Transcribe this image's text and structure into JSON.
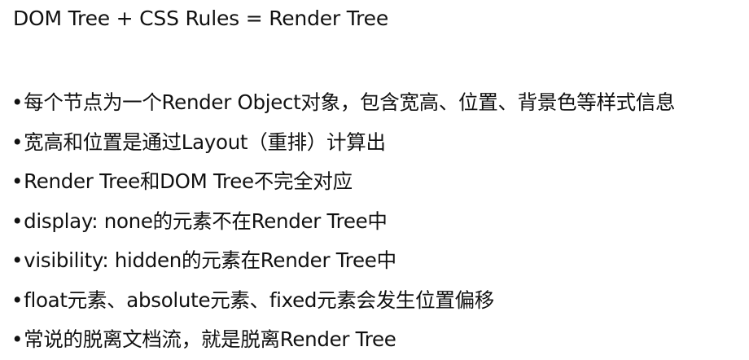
{
  "title": "DOM Tree + CSS Rules = Render Tree",
  "bullet_marker": "•",
  "bullets": [
    "每个节点为一个Render Object对象，包含宽高、位置、背景色等样式信息",
    "宽高和位置是通过Layout（重排）计算出",
    "Render Tree和DOM Tree不完全对应",
    "display: none的元素不在Render Tree中",
    "visibility: hidden的元素在Render Tree中",
    "float元素、absolute元素、fixed元素会发生位置偏移",
    "常说的脱离文档流，就是脱离Render Tree"
  ]
}
